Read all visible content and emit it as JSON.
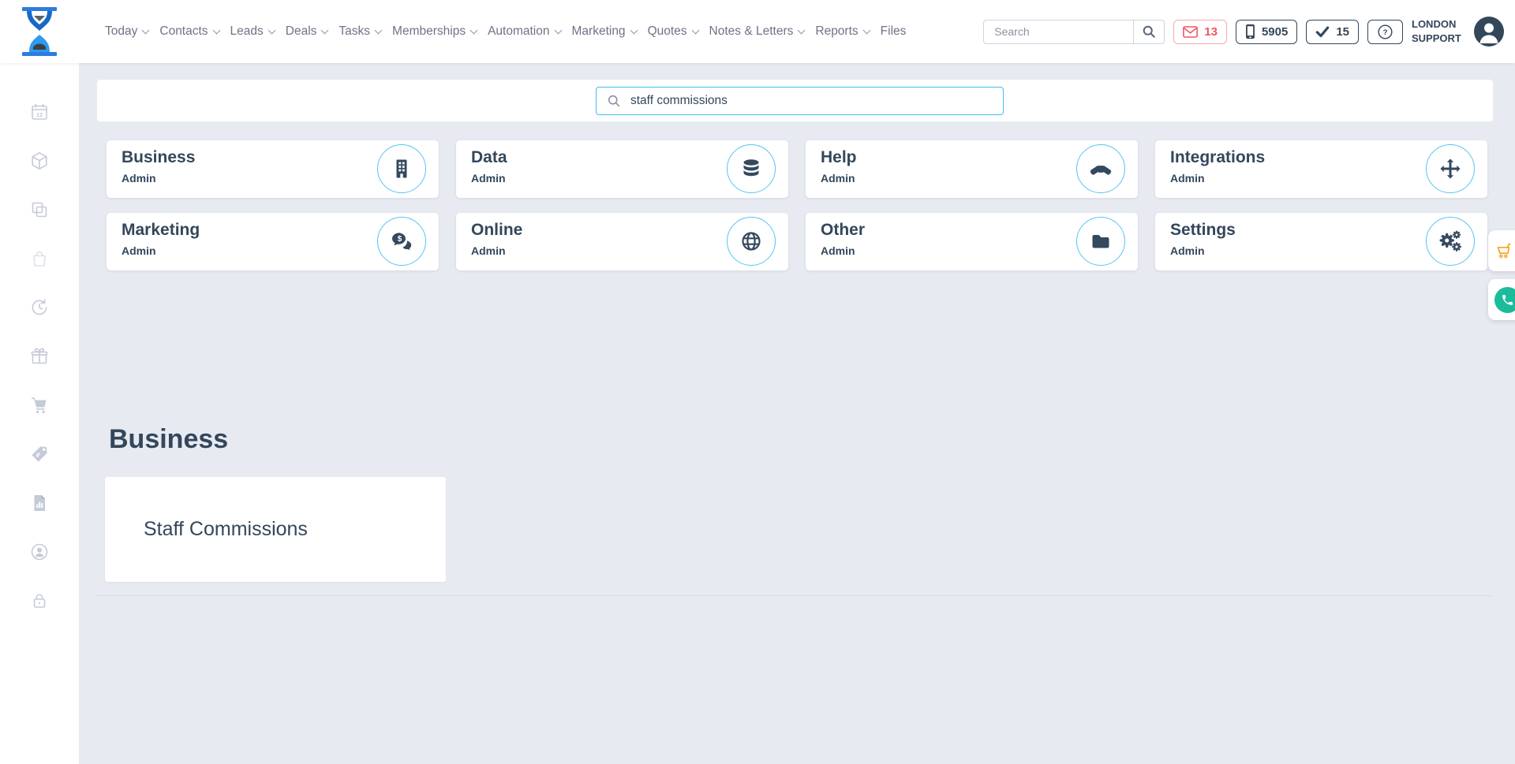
{
  "header": {
    "nav_items": [
      {
        "label": "Today",
        "dropdown": true
      },
      {
        "label": "Contacts",
        "dropdown": true
      },
      {
        "label": "Leads",
        "dropdown": true
      },
      {
        "label": "Deals",
        "dropdown": true
      },
      {
        "label": "Tasks",
        "dropdown": true
      },
      {
        "label": "Memberships",
        "dropdown": true
      },
      {
        "label": "Automation",
        "dropdown": true
      },
      {
        "label": "Marketing",
        "dropdown": true
      },
      {
        "label": "Quotes",
        "dropdown": true
      },
      {
        "label": "Notes & Letters",
        "dropdown": true
      },
      {
        "label": "Reports",
        "dropdown": true
      },
      {
        "label": "Files",
        "dropdown": false
      }
    ],
    "search_placeholder": "Search",
    "messages_count": "13",
    "phone_extension": "5905",
    "tasks_count": "15",
    "user_name": "LONDON SUPPORT"
  },
  "admin": {
    "search_value": "staff commissions",
    "categories": [
      {
        "title": "Business",
        "subtitle": "Admin",
        "icon": "building-icon"
      },
      {
        "title": "Data",
        "subtitle": "Admin",
        "icon": "database-icon"
      },
      {
        "title": "Help",
        "subtitle": "Admin",
        "icon": "handshake-icon"
      },
      {
        "title": "Integrations",
        "subtitle": "Admin",
        "icon": "move-arrows-icon"
      },
      {
        "title": "Marketing",
        "subtitle": "Admin",
        "icon": "comments-dollar-icon"
      },
      {
        "title": "Online",
        "subtitle": "Admin",
        "icon": "globe-icon"
      },
      {
        "title": "Other",
        "subtitle": "Admin",
        "icon": "folder-icon"
      },
      {
        "title": "Settings",
        "subtitle": "Admin",
        "icon": "gears-icon"
      }
    ],
    "results": {
      "heading": "Business",
      "items": [
        {
          "label": "Staff Commissions"
        }
      ]
    }
  },
  "colors": {
    "accent_cyan": "#41bdf3",
    "navy": "#33475b",
    "alert_red": "#f2545b",
    "cart_orange": "#f5a41d",
    "phone_green": "#1abc9c"
  }
}
